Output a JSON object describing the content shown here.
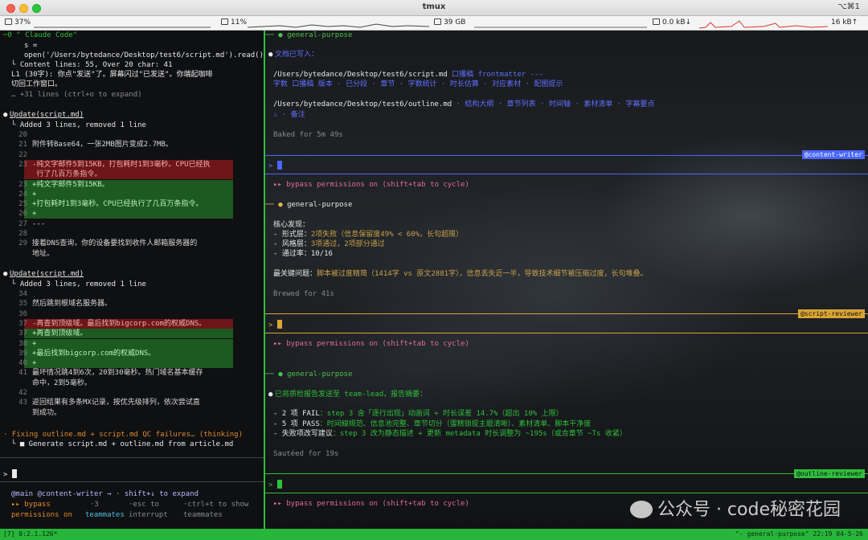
{
  "window": {
    "title": "tmux",
    "shortcut": "⌥⌘1"
  },
  "stats": {
    "battery": "37%",
    "cpu": "11%",
    "disk": "39 GB",
    "net_down": "0.0 kB↓",
    "net_up": "16 kB↑"
  },
  "left": {
    "header": "─0 \" Claude Code\"",
    "lines": [
      {
        "t": "s =",
        "c": "white"
      },
      {
        "t": "open('/Users/bytedance/Desktop/test6/script.md').read()…)",
        "c": "white"
      },
      {
        "t": "└ Content lines: 55, Over 20 char: 41",
        "c": "white"
      },
      {
        "t": "  L1 (30字): 你点\"发送\"了。屏幕闪过\"已发送\"。你端起咖啡",
        "c": "white"
      },
      {
        "t": "  切回工作窗口。",
        "c": "white"
      },
      {
        "t": "  … +31 lines (ctrl+o to expand)",
        "c": "dim"
      }
    ],
    "update1": {
      "head": "Update(script.md)",
      "summary": "└ Added 3 lines, removed 1 line",
      "rows": [
        {
          "n": "20",
          "t": ""
        },
        {
          "n": "21",
          "t": "附件转Base64，一张2MB图片变成2.7MB。"
        },
        {
          "n": "22",
          "t": ""
        },
        {
          "n": "23",
          "t": "-纯文字邮件5到15KB，打包耗时1到3毫秒。CPU已经执",
          "k": "del"
        },
        {
          "n": "",
          "t": " 行了几百万条指令。",
          "k": "del"
        },
        {
          "n": "23",
          "t": "+纯文字邮件5到15KB。",
          "k": "add"
        },
        {
          "n": "24",
          "t": "+",
          "k": "add"
        },
        {
          "n": "25",
          "t": "+打包耗时1到3毫秒。CPU已经执行了几百万条指令。",
          "k": "add"
        },
        {
          "n": "26",
          "t": "+",
          "k": "add"
        },
        {
          "n": "27",
          "t": "---"
        },
        {
          "n": "28",
          "t": ""
        },
        {
          "n": "29",
          "t": "接着DNS查询，你的设备要找到收件人邮箱服务器的"
        },
        {
          "n": "",
          "t": "地址。"
        }
      ]
    },
    "update2": {
      "head": "Update(script.md)",
      "summary": "└ Added 3 lines, removed 1 line",
      "rows": [
        {
          "n": "34",
          "t": ""
        },
        {
          "n": "35",
          "t": "然后跳到根域名服务器。"
        },
        {
          "n": "36",
          "t": ""
        },
        {
          "n": "37",
          "t": "-再查到顶级域。最后找到bigcorp.com的权威DNS。",
          "k": "del"
        },
        {
          "n": "37",
          "t": "+再查到顶级域。",
          "k": "add"
        },
        {
          "n": "38",
          "t": "+",
          "k": "add"
        },
        {
          "n": "39",
          "t": "+最后找到bigcorp.com的权威DNS。",
          "k": "add"
        },
        {
          "n": "40",
          "t": "+",
          "k": "add"
        },
        {
          "n": "41",
          "t": "最坏情况跳4到6次，20到30毫秒。热门域名基本缓存"
        },
        {
          "n": "",
          "t": "命中，2到5毫秒。"
        },
        {
          "n": "42",
          "t": ""
        },
        {
          "n": "43",
          "t": "返回结果有多条MX记录，按优先级排列，依次尝试直"
        },
        {
          "n": "",
          "t": "到成功。"
        }
      ]
    },
    "thinking": "· Fixing outline.md + script.md QC failures… (thinking)",
    "todo": "└ ■ Generate script.md + outline.md from article.md",
    "prompt": ">",
    "footer1": "@main @content-writer → · shift+↓ to expand",
    "footer2a": "▸▸ bypass",
    "footer2b": "·3",
    "footer2c": "·esc to",
    "footer2d": "·ctrl+t to show",
    "footer3a": "permissions on",
    "footer3b": "teammates",
    "footer3c": "interrupt",
    "footer3d": "teammates"
  },
  "right": {
    "s1": {
      "agent": "general-purpose",
      "l1": "文档已写入：",
      "p1": "/Users/bytedance/Desktop/test6/script.md",
      "p1b": "口播稿 frontmatter ---",
      "p1c": "字数 口播稿 版本 · 已分段 · 章节 · 字数统计 · 时长估算 · 对应素材 · 配图提示",
      "p2": "/Users/bytedance/Desktop/test6/outline.md",
      "p2b": "· 结构大纲 · 章节列表 · 时间轴 · 素材清单 · 字幕要点",
      "p2c": "⚠ · 备注",
      "baked": "Baked for 5m 49s",
      "tag": "@content-writer",
      "perm": "▸▸ bypass permissions on (shift+tab to cycle)"
    },
    "s2": {
      "agent": "general-purpose",
      "h": "核心发现：",
      "b1a": "- 形式层：",
      "b1b": "2项失败（信息保留度49% < 60%，长句超限）",
      "b2a": "- 风格层：",
      "b2b": "3项通过，2项部分通过",
      "b3a": "- 通过率：",
      "b3b": "10/16",
      "keya": "最关键问题：",
      "keyb": "脚本被过度精简（1414字 vs 原文2881字），信息丢失近一半，导致技术细节被压缩过度，长句堆叠。",
      "brewed": "Brewed for 41s",
      "tag": "@script-reviewer",
      "perm": "▸▸ bypass permissions on (shift+tab to cycle)"
    },
    "s3": {
      "agent": "general-purpose",
      "l1": "已将质检报告发送至 team-lead，报告摘要：",
      "b1a": "- 2 项 FAIL",
      "b1b": "：step 3 含「逐行出现」动画词 + 时长误差 14.7%（超出 10% 上限）",
      "b2a": "- 5 项 PASS",
      "b2b": "：时间線规范、信息池完整、章节切分（蛋糕锁提主题清晰）、素材清单、脚本干净度",
      "b3a": "- 失败项改写建议",
      "b3b": "：step 3 改为静态描述 + 更新 metadata 时长调整为 ~195s（或合章节 ~Ts 收紧）",
      "sauteed": "Sautéed for 19s",
      "tag": "@outline-reviewer",
      "perm": "▸▸ bypass permissions on (shift+tab to cycle)"
    }
  },
  "status": {
    "left": "[7] 0:2.1.126*",
    "right": "\"· general-purpose\" 22:19 04-5-26"
  },
  "watermark": "公众号 · code秘密花园"
}
